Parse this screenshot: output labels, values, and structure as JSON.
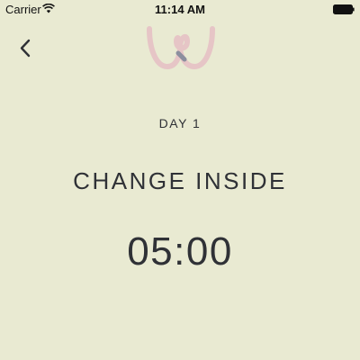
{
  "status_bar": {
    "carrier": "Carrier",
    "time": "11:14 AM"
  },
  "icons": {
    "wifi": "wifi-icon",
    "battery": "battery-icon",
    "back": "chevron-left-icon",
    "logo": "brand-logo"
  },
  "colors": {
    "background": "#e9ead2",
    "text": "#2f3136",
    "logo_pink": "#e6c5c6",
    "logo_knot": "#8c8f9e"
  },
  "workout": {
    "day_label": "DAY 1",
    "step_title": "CHANGE INSIDE",
    "timer": "05:00"
  }
}
